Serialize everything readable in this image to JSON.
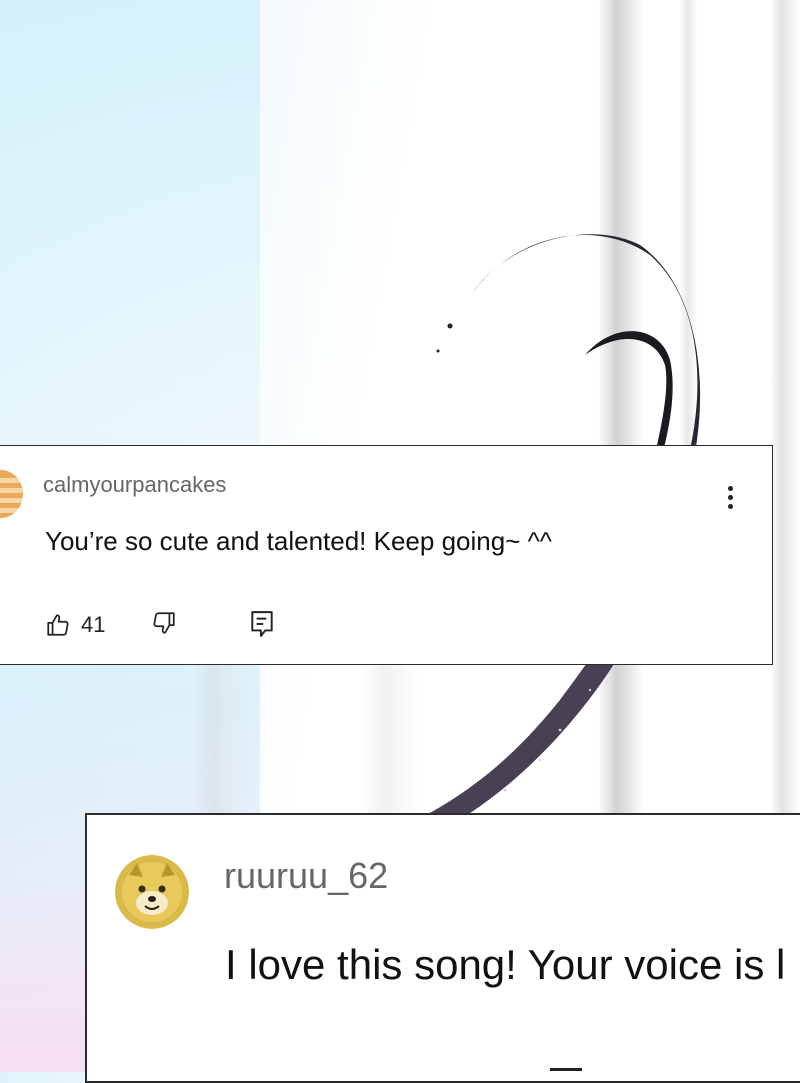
{
  "comments": [
    {
      "username": "calmyourpancakes",
      "text": "You’re so cute and talented! Keep going~ ^^",
      "likes": "41",
      "avatar_icon": "pancake-avatar",
      "more_icon": "more-vertical-icon",
      "like_icon": "thumbs-up-icon",
      "dislike_icon": "thumbs-down-icon",
      "reply_icon": "reply-comment-icon"
    },
    {
      "username": "ruuruu_62",
      "text": "I love this song! Your voice is l",
      "avatar_icon": "shiba-dog-avatar"
    }
  ],
  "colors": {
    "card_border": "#2b2b2b",
    "username": "#666666",
    "text": "#111111",
    "hair_strand": "#4a4054"
  }
}
